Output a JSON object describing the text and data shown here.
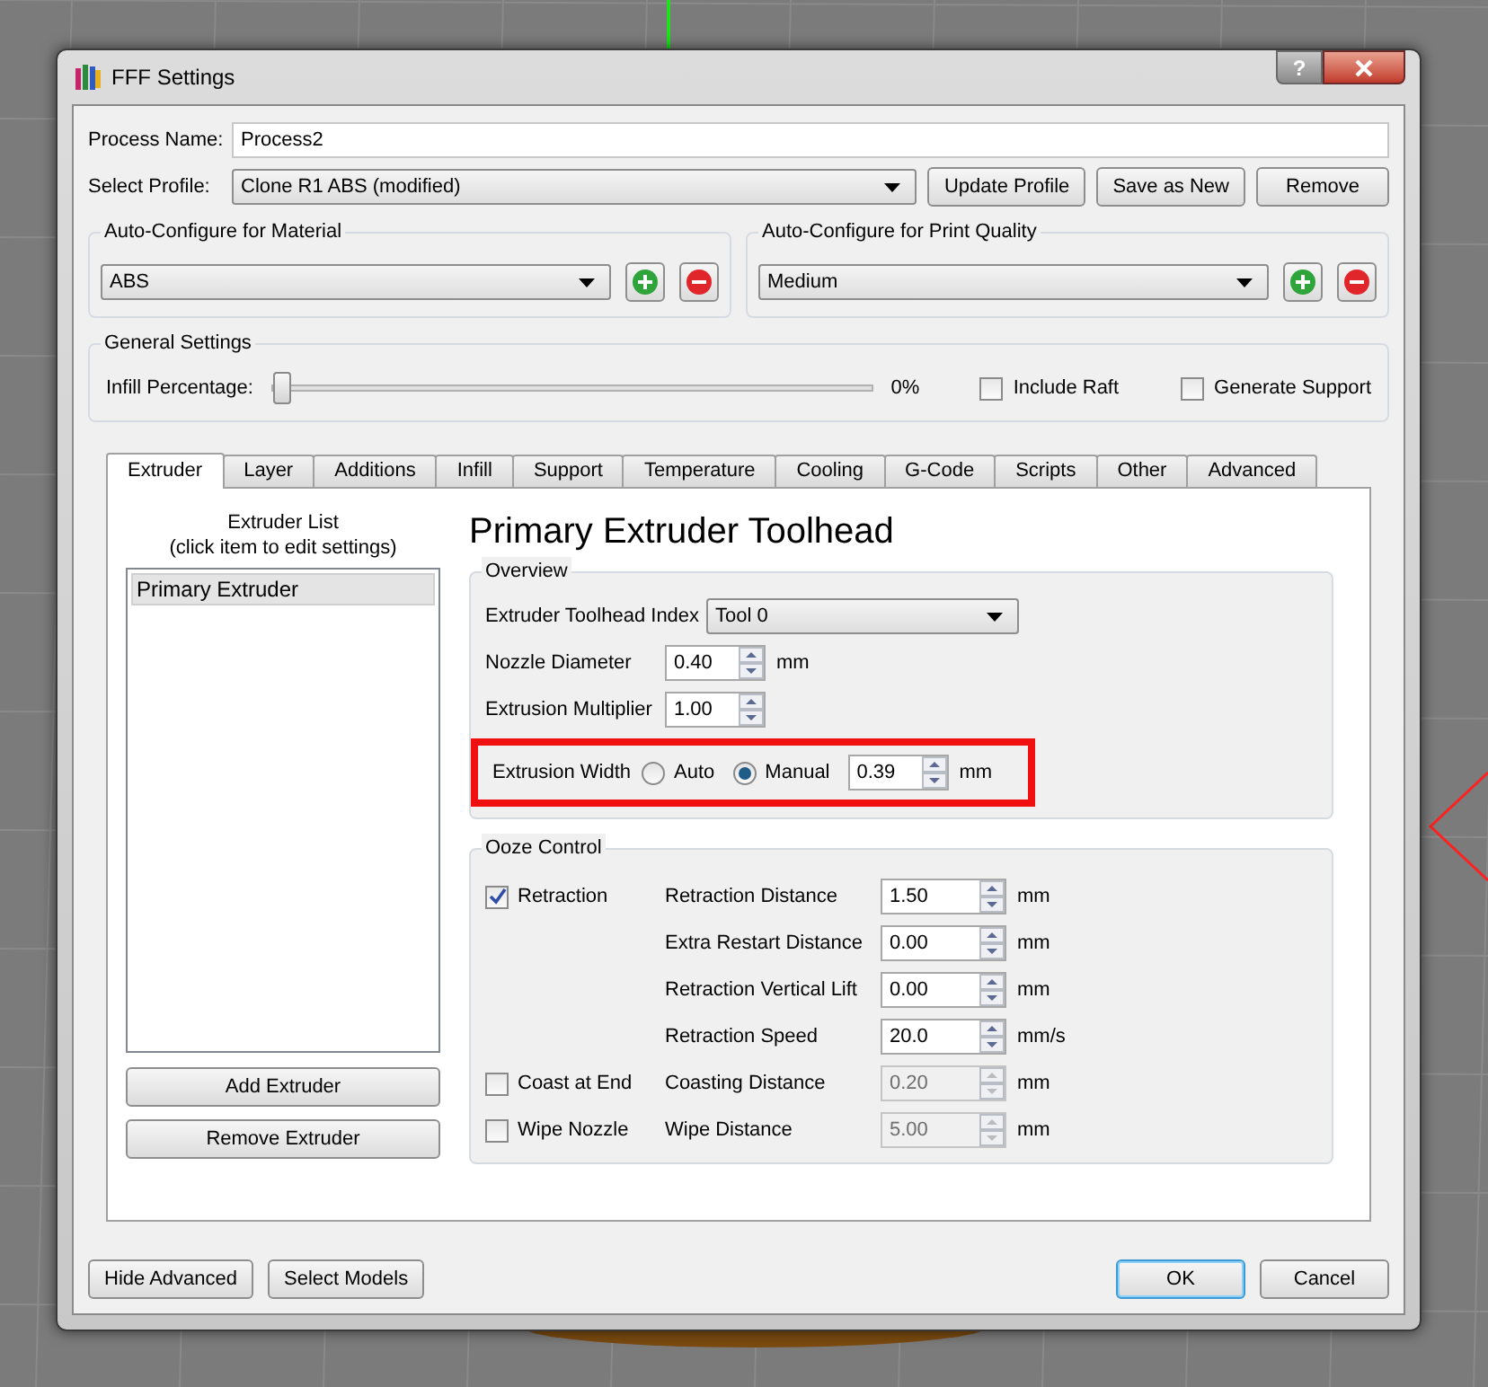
{
  "window": {
    "title": "FFF Settings",
    "help_label": "?"
  },
  "process_name": {
    "label": "Process Name:",
    "value": "Process2"
  },
  "profile": {
    "label": "Select Profile:",
    "value": "Clone R1 ABS (modified)",
    "buttons": [
      "Update Profile",
      "Save as New",
      "Remove"
    ]
  },
  "material": {
    "title": "Auto-Configure for Material",
    "value": "ABS"
  },
  "quality": {
    "title": "Auto-Configure for Print Quality",
    "value": "Medium"
  },
  "general": {
    "title": "General Settings",
    "infill_label": "Infill Percentage:",
    "level": 0,
    "reading": "0%",
    "checkboxes": [
      {
        "label": "Include Raft",
        "checked": false
      },
      {
        "label": "Generate Support",
        "checked": false
      }
    ]
  },
  "tabs": [
    {
      "label": "Extruder",
      "selected": true
    },
    {
      "label": "Layer",
      "selected": false
    },
    {
      "label": "Additions",
      "selected": false
    },
    {
      "label": "Infill",
      "selected": false
    },
    {
      "label": "Support",
      "selected": false
    },
    {
      "label": "Temperature",
      "selected": false
    },
    {
      "label": "Cooling",
      "selected": false
    },
    {
      "label": "G-Code",
      "selected": false
    },
    {
      "label": "Scripts",
      "selected": false
    },
    {
      "label": "Other",
      "selected": false
    },
    {
      "label": "Advanced",
      "selected": false
    }
  ],
  "extruder_list": {
    "title": "Extruder List",
    "subtitle": "(click item to edit settings)",
    "items": [
      {
        "label": "Primary Extruder",
        "selected": true
      }
    ],
    "buttons": [
      "Add Extruder",
      "Remove Extruder"
    ]
  },
  "heading": "Primary Extruder Toolhead",
  "overview": {
    "title": "Overview",
    "toolhead_index": {
      "label": "Extruder Toolhead Index",
      "value": "Tool 0"
    },
    "fields": [
      {
        "label": "Nozzle Diameter",
        "value": "0.40",
        "unit": "mm"
      },
      {
        "label": "Extrusion Multiplier",
        "value": "1.00"
      }
    ],
    "extrusion_width": {
      "label": "Extrusion Width",
      "highlighted": true,
      "options": [
        {
          "label": "Auto",
          "selected": false
        },
        {
          "label": "Manual",
          "selected": true
        }
      ],
      "value": "0.39",
      "unit": "mm"
    }
  },
  "ooze": {
    "title": "Ooze Control",
    "rows": [
      {
        "checkbox": {
          "label": "Retraction",
          "checked": true
        },
        "label": "Retraction Distance",
        "value": "1.50",
        "unit": "mm",
        "disabled": false
      },
      {
        "label": "Extra Restart Distance",
        "value": "0.00",
        "unit": "mm",
        "disabled": false
      },
      {
        "label": "Retraction Vertical Lift",
        "value": "0.00",
        "unit": "mm",
        "disabled": false
      },
      {
        "label": "Retraction Speed",
        "value": "20.0",
        "unit": "mm/s",
        "disabled": false
      },
      {
        "checkbox": {
          "label": "Coast at End",
          "checked": false
        },
        "label": "Coasting Distance",
        "value": "0.20",
        "unit": "mm",
        "disabled": true
      },
      {
        "checkbox": {
          "label": "Wipe Nozzle",
          "checked": false
        },
        "label": "Wipe Distance",
        "value": "5.00",
        "unit": "mm",
        "disabled": true
      }
    ]
  },
  "footer": {
    "left_buttons": [
      "Hide Advanced",
      "Select Models"
    ],
    "right_buttons": [
      {
        "label": "OK",
        "default": true
      },
      {
        "label": "Cancel",
        "default": false
      }
    ]
  }
}
